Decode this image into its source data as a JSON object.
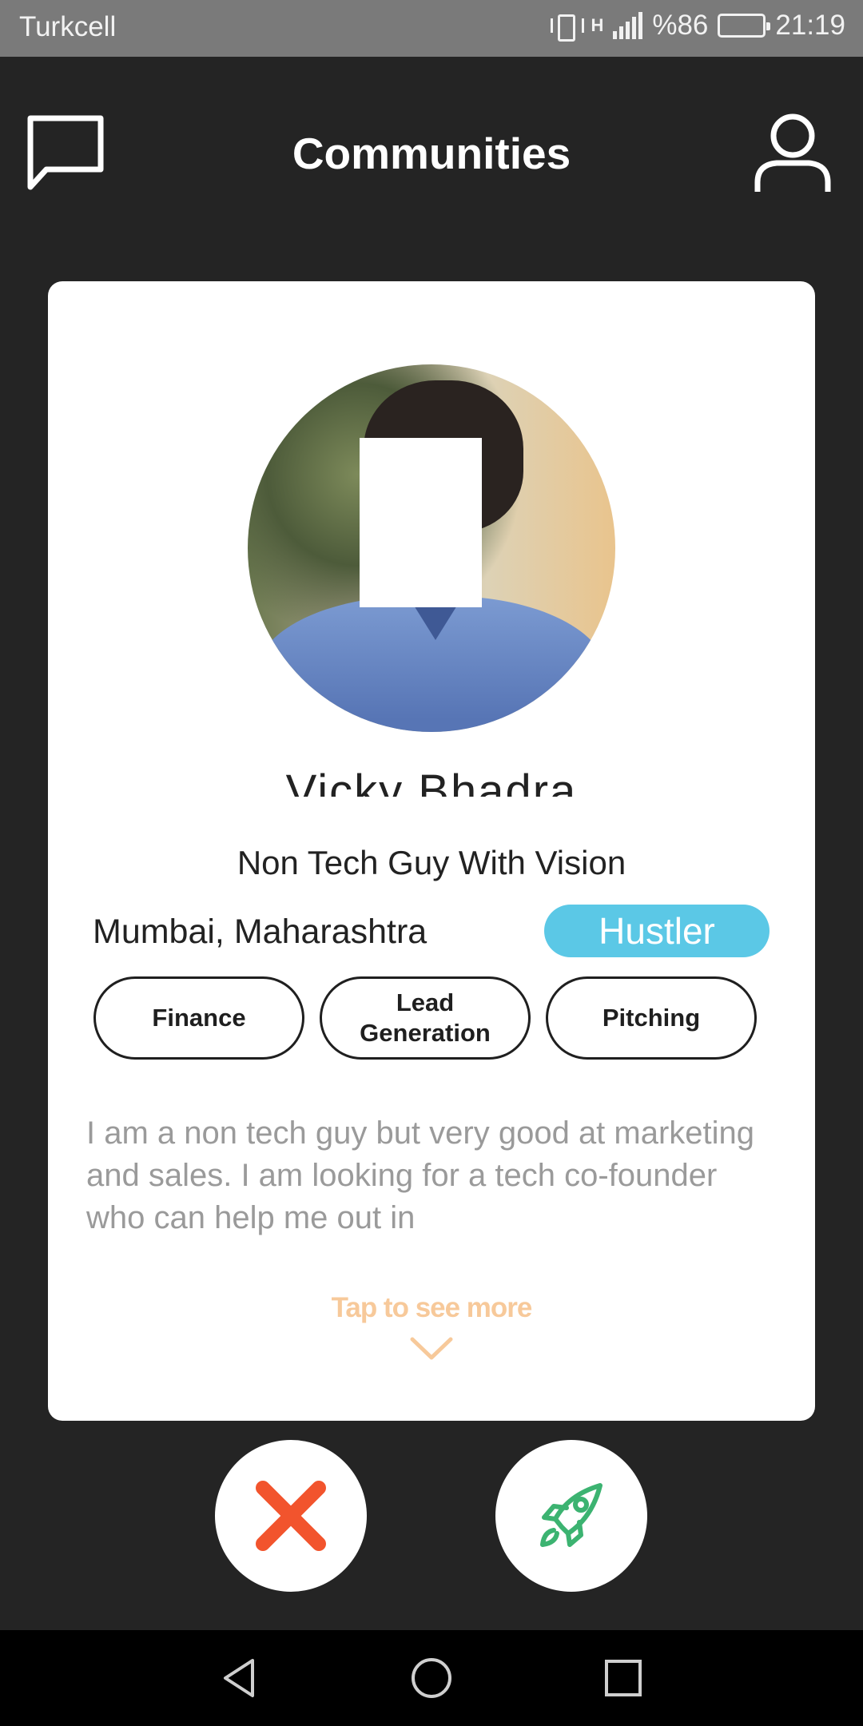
{
  "status_bar": {
    "carrier": "Turkcell",
    "network": "H",
    "battery": "%86",
    "time": "21:19"
  },
  "header": {
    "title": "Communities",
    "left_icon": "chat-bubble-icon",
    "right_icon": "user-profile-icon"
  },
  "profile_card": {
    "name": "Vicky Bhadra",
    "tagline": "Non Tech Guy With Vision",
    "location": "Mumbai, Maharashtra",
    "badge": "Hustler",
    "skills": [
      "Finance",
      "Lead Generation",
      "Pitching"
    ],
    "bio": "I am a non tech guy but very good at marketing and sales. I am looking for a tech co-founder who can help me out in",
    "see_more": "Tap to see more"
  },
  "actions": {
    "reject_icon": "close-icon",
    "boost_icon": "rocket-icon"
  },
  "colors": {
    "background": "#242424",
    "badge": "#5bc8e6",
    "reject": "#f2542d",
    "boost": "#3cb371",
    "see_more": "#f7c99a"
  }
}
